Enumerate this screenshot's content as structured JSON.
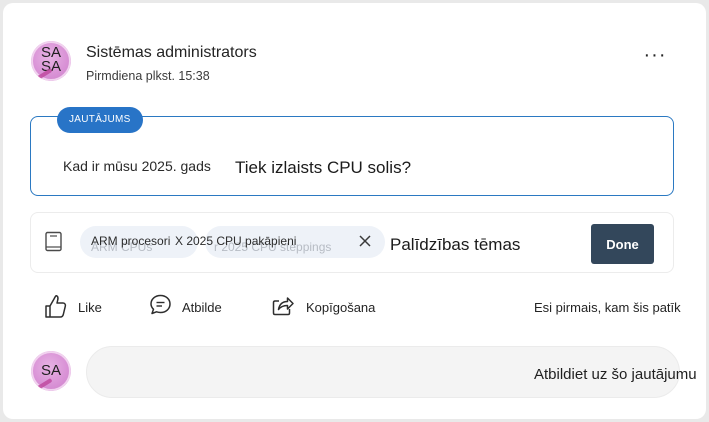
{
  "post": {
    "author": {
      "initials_stacked": "SA",
      "initials": "SA",
      "name": "Sistēmas administrators",
      "timestamp": "Pirmdiena plkst. 15:38"
    },
    "more_label": "···",
    "question": {
      "badge": "JAUTĀJUMS",
      "prefix": "Kad ir mūsu 2025. gads",
      "text": "Tiek izlaists CPU solis?"
    },
    "topics": {
      "chips": [
        {
          "label": "ARM procesori",
          "ghost": "ARM CPUs"
        },
        {
          "label": "X 2025 CPU pakāpieni",
          "ghost": "r 2025 CPU steppings"
        }
      ],
      "label": "Palīdzības tēmas",
      "done_label": "Done"
    },
    "actions": {
      "like": "Like",
      "reply": "Atbilde",
      "share": "Kopīgošana"
    },
    "first_like_text": "Esi pirmais, kam šis patīk"
  },
  "reply_box": {
    "initials": "SA",
    "placeholder": "Atbildiet uz šo jautājumu"
  },
  "colors": {
    "accent_blue": "#2874c7",
    "done_button": "#33475b",
    "avatar_pink": "#d992d6"
  }
}
